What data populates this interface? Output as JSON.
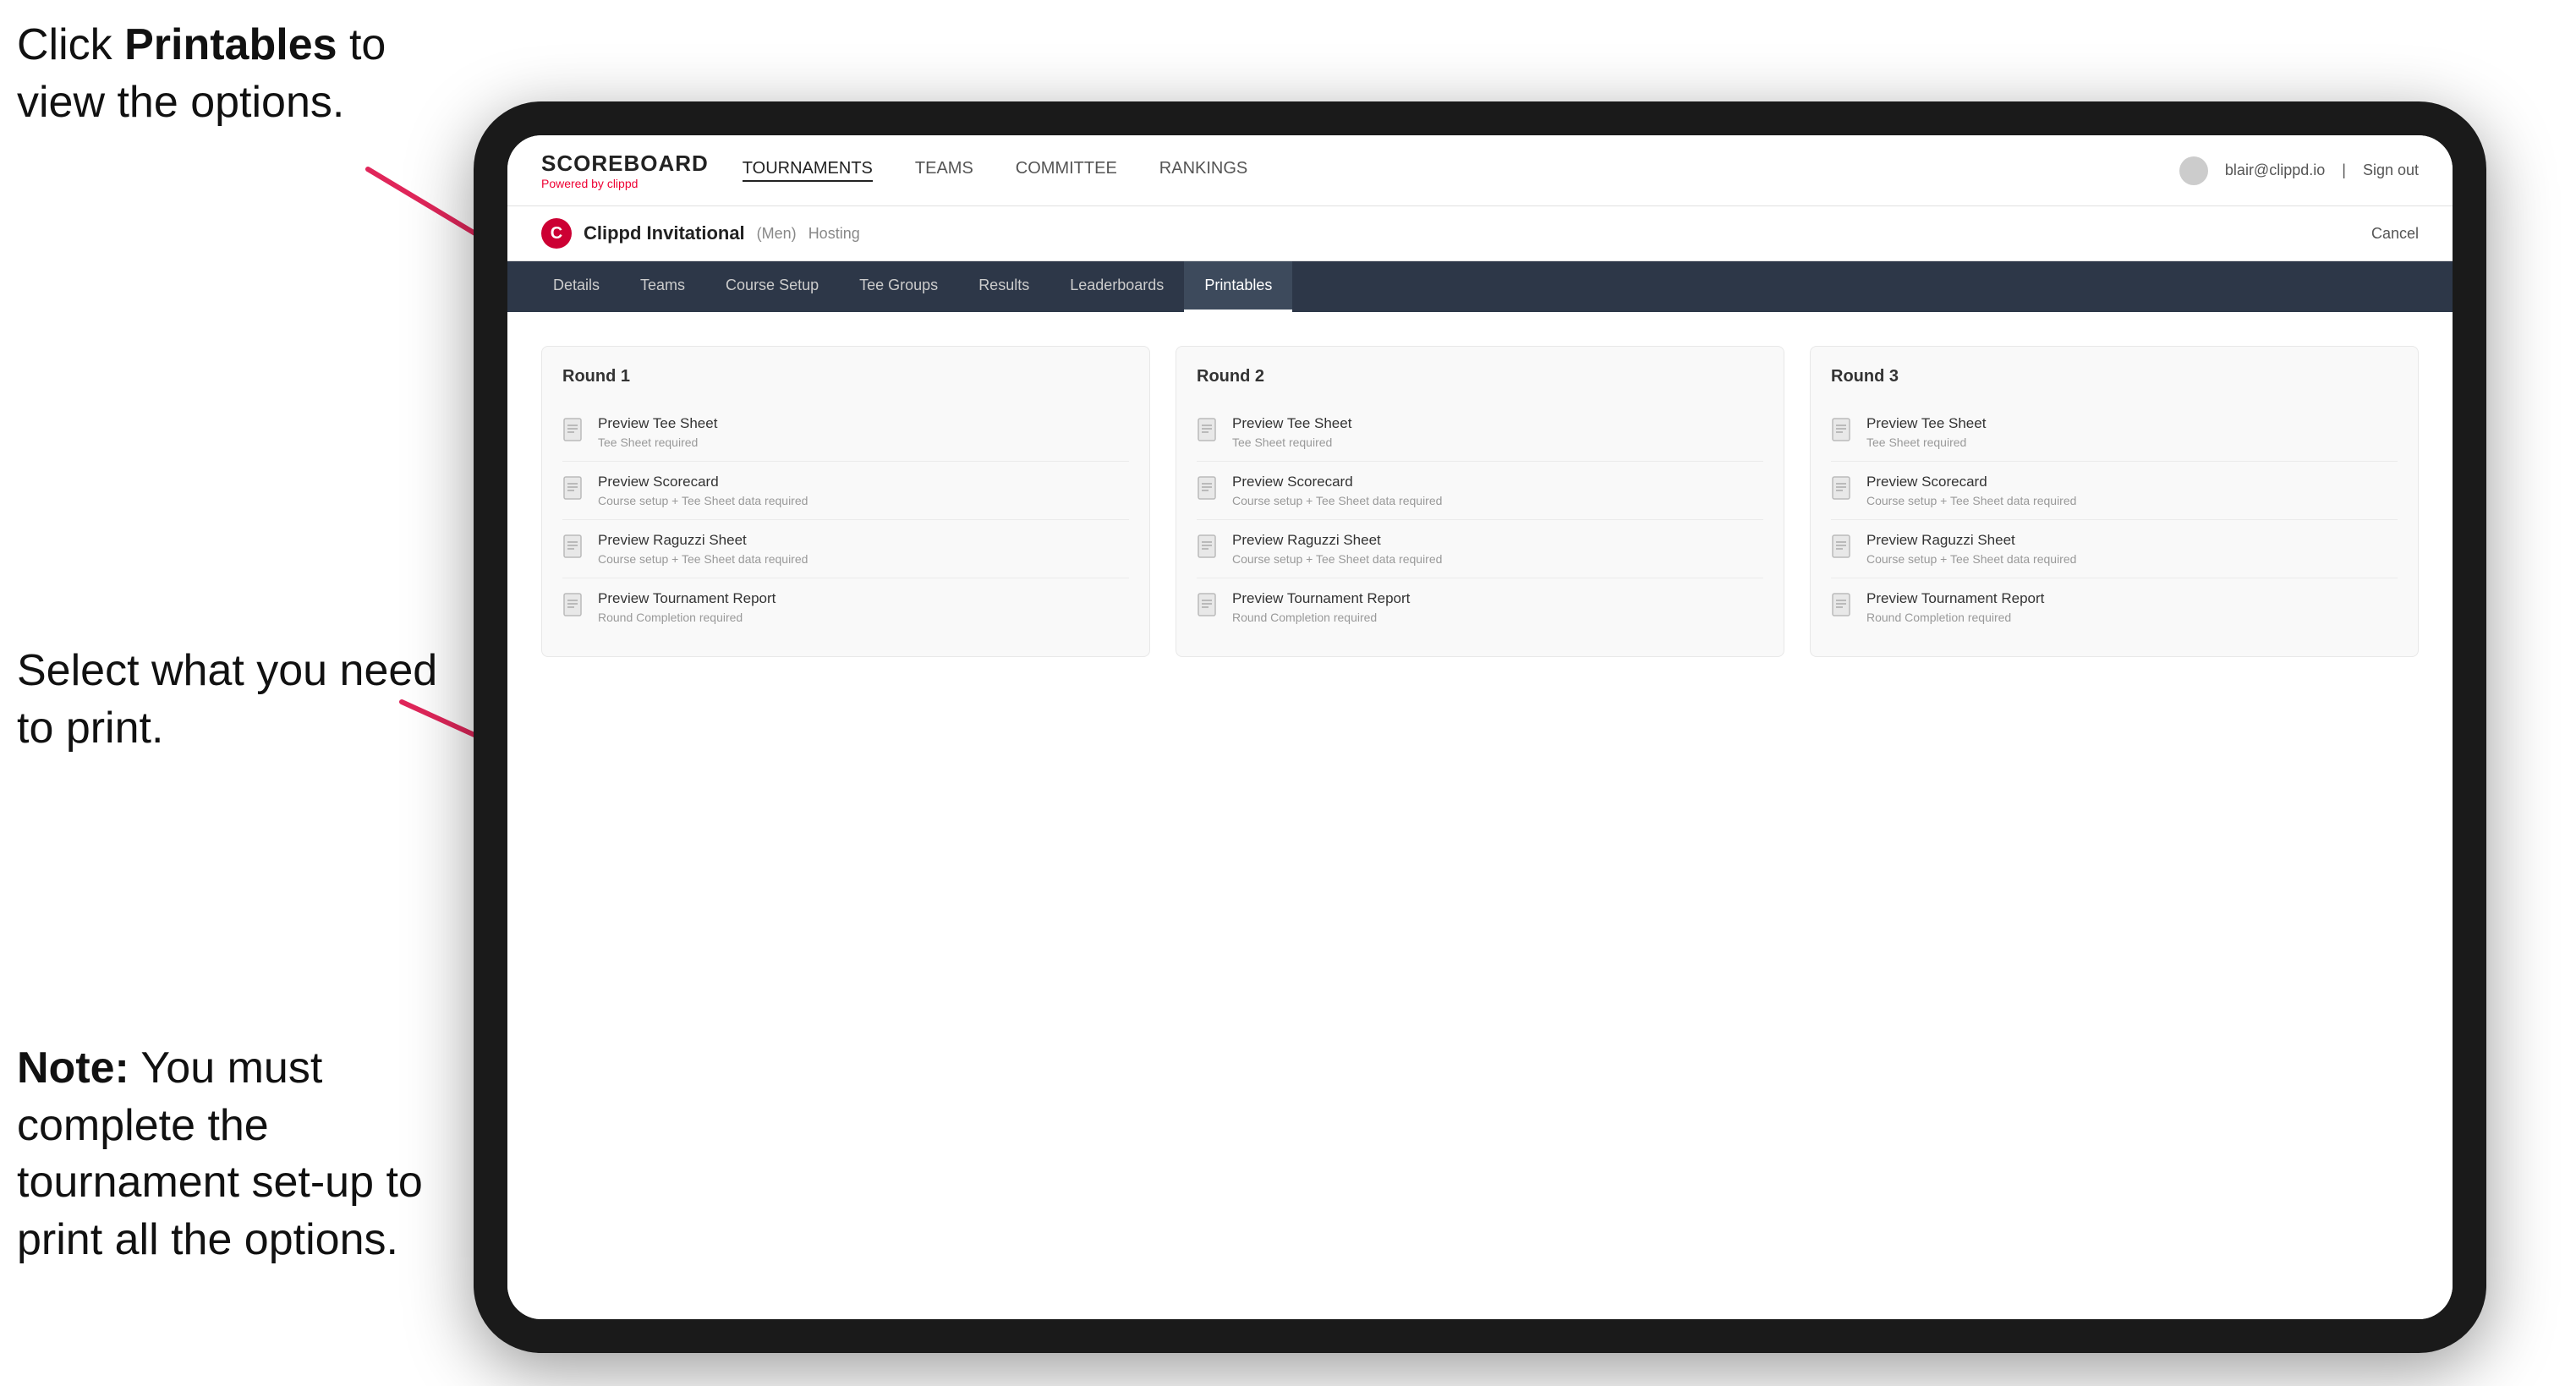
{
  "annotations": {
    "top": {
      "prefix": "Click ",
      "bold": "Printables",
      "suffix": " to view the options."
    },
    "middle": {
      "text": "Select what you need to print."
    },
    "bottom": {
      "bold": "Note:",
      "suffix": " You must complete the tournament set-up to print all the options."
    }
  },
  "brand": {
    "title": "SCOREBOARD",
    "subtitle": "Powered by clippd"
  },
  "nav": {
    "links": [
      "TOURNAMENTS",
      "TEAMS",
      "COMMITTEE",
      "RANKINGS"
    ],
    "user": "blair@clippd.io",
    "signout": "Sign out"
  },
  "tournament": {
    "name": "Clippd Invitational",
    "division": "(Men)",
    "status": "Hosting",
    "logo": "C",
    "cancel": "Cancel"
  },
  "tabs": [
    "Details",
    "Teams",
    "Course Setup",
    "Tee Groups",
    "Results",
    "Leaderboards",
    "Printables"
  ],
  "active_tab": "Printables",
  "rounds": [
    {
      "title": "Round 1",
      "items": [
        {
          "name": "Preview Tee Sheet",
          "req": "Tee Sheet required"
        },
        {
          "name": "Preview Scorecard",
          "req": "Course setup + Tee Sheet data required"
        },
        {
          "name": "Preview Raguzzi Sheet",
          "req": "Course setup + Tee Sheet data required"
        },
        {
          "name": "Preview Tournament Report",
          "req": "Round Completion required"
        }
      ]
    },
    {
      "title": "Round 2",
      "items": [
        {
          "name": "Preview Tee Sheet",
          "req": "Tee Sheet required"
        },
        {
          "name": "Preview Scorecard",
          "req": "Course setup + Tee Sheet data required"
        },
        {
          "name": "Preview Raguzzi Sheet",
          "req": "Course setup + Tee Sheet data required"
        },
        {
          "name": "Preview Tournament Report",
          "req": "Round Completion required"
        }
      ]
    },
    {
      "title": "Round 3",
      "items": [
        {
          "name": "Preview Tee Sheet",
          "req": "Tee Sheet required"
        },
        {
          "name": "Preview Scorecard",
          "req": "Course setup + Tee Sheet data required"
        },
        {
          "name": "Preview Raguzzi Sheet",
          "req": "Course setup + Tee Sheet data required"
        },
        {
          "name": "Preview Tournament Report",
          "req": "Round Completion required"
        }
      ]
    }
  ]
}
